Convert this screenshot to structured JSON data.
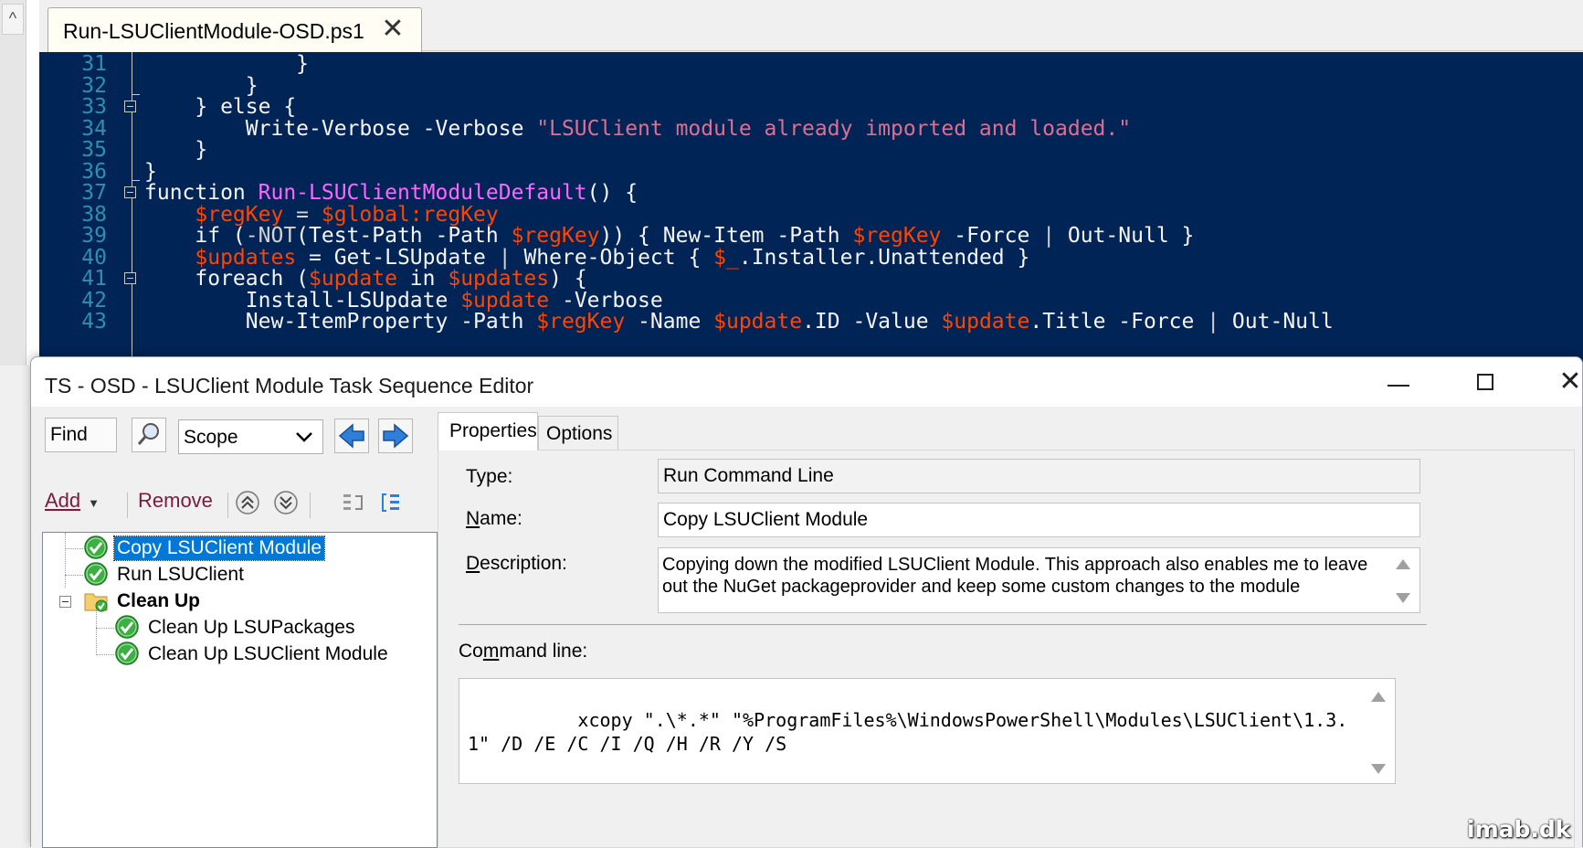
{
  "ise": {
    "tab_title": "Run-LSUClientModule-OSD.ps1",
    "tab_close": "✕",
    "lines": [
      {
        "n": "31",
        "code": [
          {
            "t": "            }",
            "c": "plain"
          }
        ]
      },
      {
        "n": "32",
        "code": [
          {
            "t": "        }",
            "c": "plain"
          }
        ]
      },
      {
        "n": "33",
        "code": [
          {
            "t": "    } else {",
            "c": "plain"
          }
        ]
      },
      {
        "n": "34",
        "code": [
          {
            "t": "        Write-Verbose ",
            "c": "plain"
          },
          {
            "t": "-Verbose ",
            "c": "plain"
          },
          {
            "t": "\"LSUClient module already imported and loaded.\"",
            "c": "str"
          }
        ]
      },
      {
        "n": "35",
        "code": [
          {
            "t": "    }",
            "c": "plain"
          }
        ]
      },
      {
        "n": "36",
        "code": [
          {
            "t": "}",
            "c": "plain"
          }
        ]
      },
      {
        "n": "37",
        "code": [
          {
            "t": "function ",
            "c": "plain"
          },
          {
            "t": "Run-LSUClientModuleDefault",
            "c": "fn"
          },
          {
            "t": "() {",
            "c": "plain"
          }
        ]
      },
      {
        "n": "38",
        "code": [
          {
            "t": "    ",
            "c": "plain"
          },
          {
            "t": "$regKey",
            "c": "var"
          },
          {
            "t": " = ",
            "c": "op"
          },
          {
            "t": "$global:regKey",
            "c": "var"
          }
        ]
      },
      {
        "n": "39",
        "code": [
          {
            "t": "    if (",
            "c": "plain"
          },
          {
            "t": "-NOT",
            "c": "op"
          },
          {
            "t": "(Test-Path -Path ",
            "c": "plain"
          },
          {
            "t": "$regKey",
            "c": "var"
          },
          {
            "t": ")) { New-Item -Path ",
            "c": "plain"
          },
          {
            "t": "$regKey",
            "c": "var"
          },
          {
            "t": " -Force ",
            "c": "plain"
          },
          {
            "t": "|",
            "c": "op"
          },
          {
            "t": " Out-Null }",
            "c": "plain"
          }
        ]
      },
      {
        "n": "40",
        "code": [
          {
            "t": "    ",
            "c": "plain"
          },
          {
            "t": "$updates",
            "c": "var"
          },
          {
            "t": " = Get-LSUpdate ",
            "c": "plain"
          },
          {
            "t": "|",
            "c": "op"
          },
          {
            "t": " Where-Object { ",
            "c": "plain"
          },
          {
            "t": "$_",
            "c": "var"
          },
          {
            "t": ".Installer.Unattended }",
            "c": "plain"
          }
        ]
      },
      {
        "n": "41",
        "code": [
          {
            "t": "    foreach (",
            "c": "plain"
          },
          {
            "t": "$update",
            "c": "var"
          },
          {
            "t": " in ",
            "c": "plain"
          },
          {
            "t": "$updates",
            "c": "var"
          },
          {
            "t": ") {",
            "c": "plain"
          }
        ]
      },
      {
        "n": "42",
        "code": [
          {
            "t": "        Install-LSUpdate ",
            "c": "plain"
          },
          {
            "t": "$update",
            "c": "var"
          },
          {
            "t": " -Verbose",
            "c": "plain"
          }
        ]
      },
      {
        "n": "43",
        "code": [
          {
            "t": "        New-ItemProperty -Path ",
            "c": "plain"
          },
          {
            "t": "$regKey",
            "c": "var"
          },
          {
            "t": " -Name ",
            "c": "plain"
          },
          {
            "t": "$update",
            "c": "var"
          },
          {
            "t": ".ID -Value ",
            "c": "plain"
          },
          {
            "t": "$update",
            "c": "var"
          },
          {
            "t": ".Title -Force ",
            "c": "plain"
          },
          {
            "t": "|",
            "c": "op"
          },
          {
            "t": " Out-Null",
            "c": "plain"
          }
        ]
      }
    ]
  },
  "window": {
    "title": "TS - OSD - LSUClient Module Task Sequence Editor",
    "close_glyph": "✕"
  },
  "left": {
    "find_label": "Find",
    "scope_value": "Scope",
    "add_label": "Add",
    "add_caret": "▼",
    "remove_label": "Remove",
    "tree": [
      {
        "label": "Copy LSUClient Module",
        "level": 0,
        "icon": "check-icon",
        "selected": true
      },
      {
        "label": "Run LSUClient",
        "level": 0,
        "icon": "check-icon",
        "selected": false
      },
      {
        "label": "Clean Up",
        "level": 0,
        "icon": "folder-check-icon",
        "group": true
      },
      {
        "label": "Clean Up LSUPackages",
        "level": 1,
        "icon": "check-icon",
        "selected": false
      },
      {
        "label": "Clean Up LSUClient Module",
        "level": 1,
        "icon": "check-icon",
        "selected": false
      }
    ]
  },
  "right": {
    "tabs": [
      {
        "label": "Properties"
      },
      {
        "label": "Options"
      }
    ],
    "type_label": "Type:",
    "type_value": "Run Command Line",
    "name_label": "Name:",
    "name_value": "Copy LSUClient Module",
    "desc_label": "Description:",
    "desc_value": "Copying down the modified LSUClient Module. This approach also enables me to leave out the NuGet packageprovider and keep some custom changes to the module",
    "cmd_label": "Command line:",
    "cmd_value": "xcopy \".\\*.*\" \"%ProgramFiles%\\WindowsPowerShell\\Modules\\LSUClient\\1.3.1\" /D /E /C /I /Q /H /R /Y /S"
  },
  "watermark": "imab.dk",
  "colors": {
    "editor_bg": "#012456",
    "selection": "#0078d7",
    "accent_text": "#7a1b3d"
  }
}
